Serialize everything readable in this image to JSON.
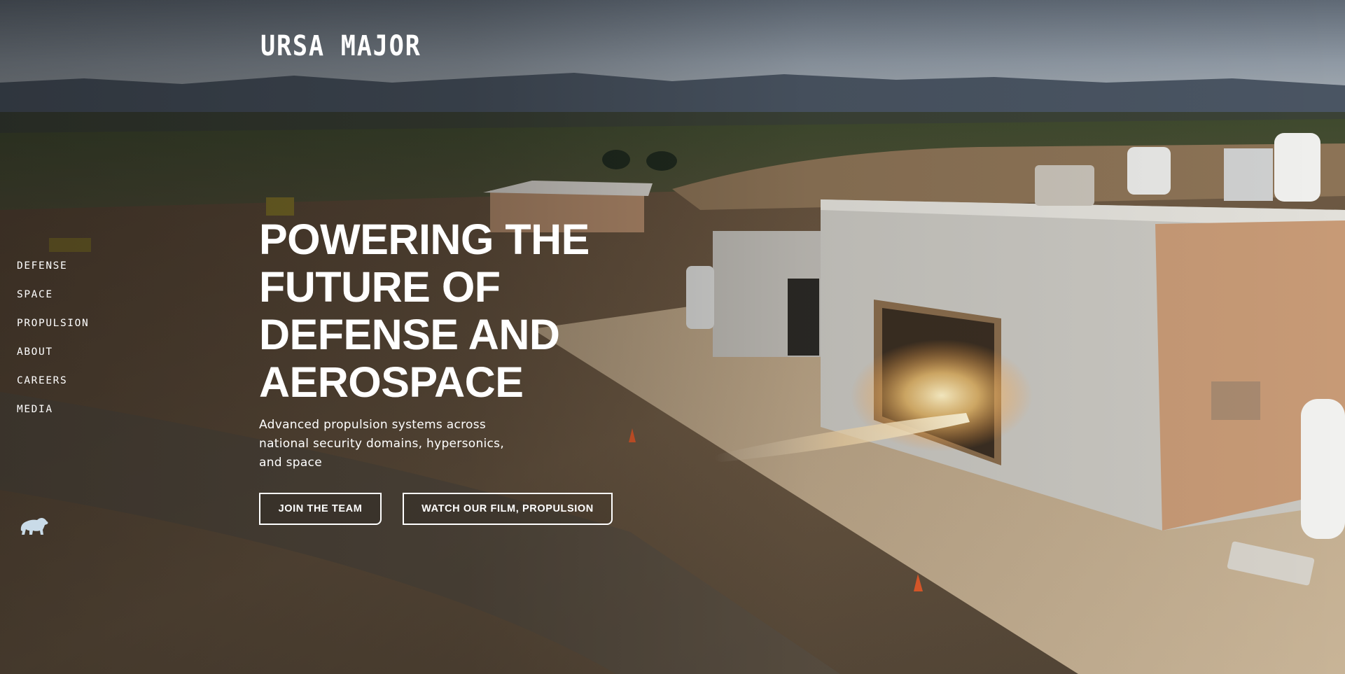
{
  "brand": {
    "logo_text": "URSA MAJOR"
  },
  "nav": {
    "items": [
      {
        "label": "DEFENSE"
      },
      {
        "label": "SPACE"
      },
      {
        "label": "PROPULSION"
      },
      {
        "label": "ABOUT"
      },
      {
        "label": "CAREERS"
      },
      {
        "label": "MEDIA"
      }
    ]
  },
  "hero": {
    "title_lines": [
      "POWERING THE",
      "FUTURE OF",
      "DEFENSE AND",
      "AEROSPACE"
    ],
    "subtitle_lines": [
      "Advanced propulsion systems across",
      "national security domains, hypersonics,",
      "and space"
    ],
    "buttons": {
      "join": "JOIN THE TEAM",
      "film": "WATCH OUR FILM, PROPULSION"
    }
  },
  "icons": {
    "bear": "bear-icon"
  },
  "colors": {
    "text": "#ffffff",
    "sky": "#8f9aa5",
    "ground": "#6b5a44",
    "building": "#cfcdc6",
    "flame": "#ffd27a"
  }
}
